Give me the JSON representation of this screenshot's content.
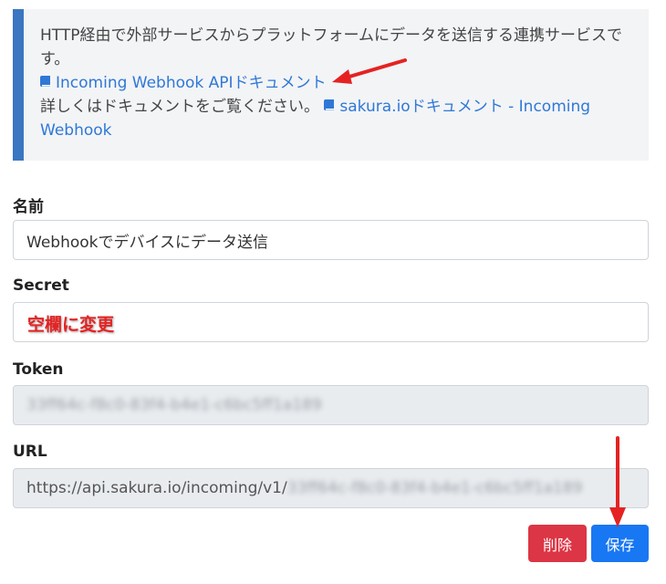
{
  "info": {
    "description": "HTTP経由で外部サービスからプラットフォームにデータを送信する連携サービスです。",
    "api_doc_link": "Incoming Webhook APIドキュメント",
    "detail_text": "詳しくはドキュメントをご覧ください。",
    "sakura_doc_link": "sakura.ioドキュメント - Incoming Webhook"
  },
  "form": {
    "name_label": "名前",
    "name_value": "Webhookでデバイスにデータ送信",
    "secret_label": "Secret",
    "secret_value": "",
    "secret_annotation": "空欄に変更",
    "token_label": "Token",
    "token_value": "33ff64c-f8c0-83f4-b4e1-c6bc5ff1a189",
    "url_label": "URL",
    "url_prefix": "https://api.sakura.io/incoming/v1/",
    "url_token": "33ff64c-f8c0-83f4-b4e1-c6bc5ff1a189"
  },
  "buttons": {
    "delete_label": "削除",
    "save_label": "保存"
  },
  "colors": {
    "accent": "#3b76c1",
    "link": "#2f78d6",
    "danger": "#dc3545",
    "primary": "#1877f2",
    "annotation": "#e52222"
  }
}
